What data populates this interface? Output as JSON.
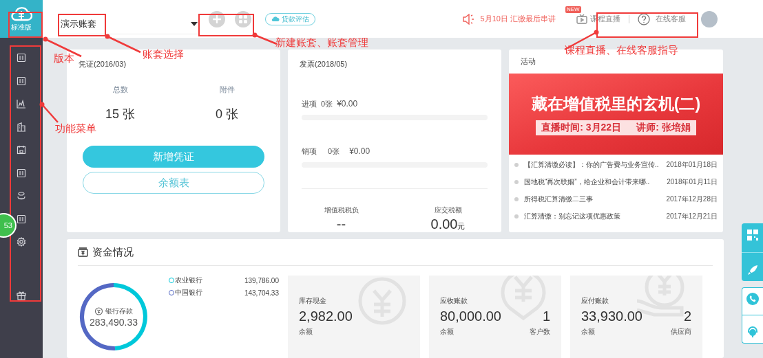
{
  "sidebar": {
    "edition": "标准版",
    "badge": "53"
  },
  "topbar": {
    "account_select": {
      "value": "演示账套"
    },
    "loan_button": "贷款评估",
    "notice": "5月10日 汇缴最后串讲",
    "new_badge": "NEW",
    "course_link": "课程直播",
    "service_link": "在线客服"
  },
  "voucher_card": {
    "title": "凭证(2016/03)",
    "stats": [
      {
        "label": "总数",
        "value": "15",
        "unit": "张"
      },
      {
        "label": "附件",
        "value": "0",
        "unit": "张"
      }
    ],
    "buttons": [
      {
        "label": "新增凭证",
        "kind": "primary"
      },
      {
        "label": "余额表",
        "kind": "outline"
      }
    ]
  },
  "invoice_card": {
    "title": "发票(2018/05)",
    "rows": [
      {
        "label": "进项",
        "count": "0张",
        "amount": "¥0.00"
      },
      {
        "label": "销项",
        "count": "0张",
        "amount": "¥0.00"
      }
    ],
    "tax": [
      {
        "label": "增值税税负",
        "value": "--"
      },
      {
        "label": "应交税额",
        "value": "0.00",
        "unit": "元"
      }
    ]
  },
  "activity_card": {
    "title": "活动",
    "banner": {
      "headline": "藏在增值税里的玄机(二)",
      "time": "直播时间: 3月22日",
      "teacher": "讲师: 张培娟"
    },
    "news": [
      {
        "title": "【汇算清缴必读】：你的广告费与业务宣传..",
        "date": "2018年01月18日"
      },
      {
        "title": "国地税“再次联姻”，给企业和会计带来哪..",
        "date": "2018年01月11日"
      },
      {
        "title": "所得税汇算清缴二三事",
        "date": "2017年12月28日"
      },
      {
        "title": "汇算清缴：别忘记这项优惠政策",
        "date": "2017年12月21日"
      }
    ]
  },
  "funds": {
    "title": "资金情况",
    "bank": {
      "label": "银行存款",
      "total": "283,490.33",
      "legend_values": [
        "139,786.00",
        "143,704.33"
      ],
      "chart_data": {
        "type": "donut",
        "categories": [
          "农业银行",
          "中国银行"
        ],
        "values": [
          49.31,
          50.69
        ],
        "colors": [
          "#00c8da",
          "#5468c4"
        ]
      }
    },
    "stats": [
      {
        "kind": "cash",
        "label": "库存现金",
        "amount": "2,982.00",
        "amount_label": "余额"
      },
      {
        "kind": "receivable",
        "label": "应收账款",
        "amount": "80,000.00",
        "amount_label": "余额",
        "count": "1",
        "count_label": "客户数"
      },
      {
        "kind": "payable",
        "label": "应付账款",
        "amount": "33,930.00",
        "amount_label": "余额",
        "count": "2",
        "count_label": "供应商"
      }
    ]
  },
  "annotations": [
    "版本",
    "账套选择",
    "新建账套、账套管理",
    "课程直播、在线客服指导",
    "功能菜单"
  ]
}
